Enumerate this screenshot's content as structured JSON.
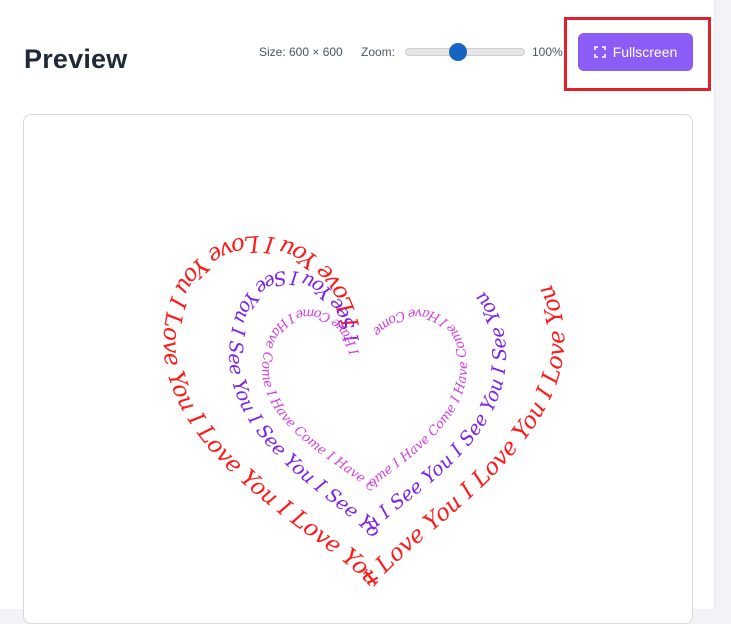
{
  "header": {
    "title": "Preview",
    "size_label": "Size: 600 × 600",
    "zoom_label": "Zoom:",
    "zoom_value": "100%",
    "zoom_level_percent": 100,
    "fullscreen_label": "Fullscreen",
    "fullscreen_icon": "expand-corners-icon"
  },
  "colors": {
    "accent": "#8b5cf6",
    "slider_thumb": "#1565c0",
    "highlight": "#e0202a",
    "outer_text": "#ff1a1a",
    "middle_text": "#7c22e8",
    "inner_text": "#d43ce0"
  },
  "preview": {
    "rings": [
      {
        "name": "outer",
        "text": "I Love You I Love You I Love You I Love You I Love You I Love You I Love You I Love You",
        "color": "#ff1a1a"
      },
      {
        "name": "middle",
        "text": "I See You I See You I See You I See You I See You I See You I See You I See You",
        "color": "#7c22e8"
      },
      {
        "name": "inner",
        "text": "I Have Come I Have Come I Have Come I Have Come I Have Come I Have Come I Have Come",
        "color": "#d43ce0"
      }
    ]
  }
}
